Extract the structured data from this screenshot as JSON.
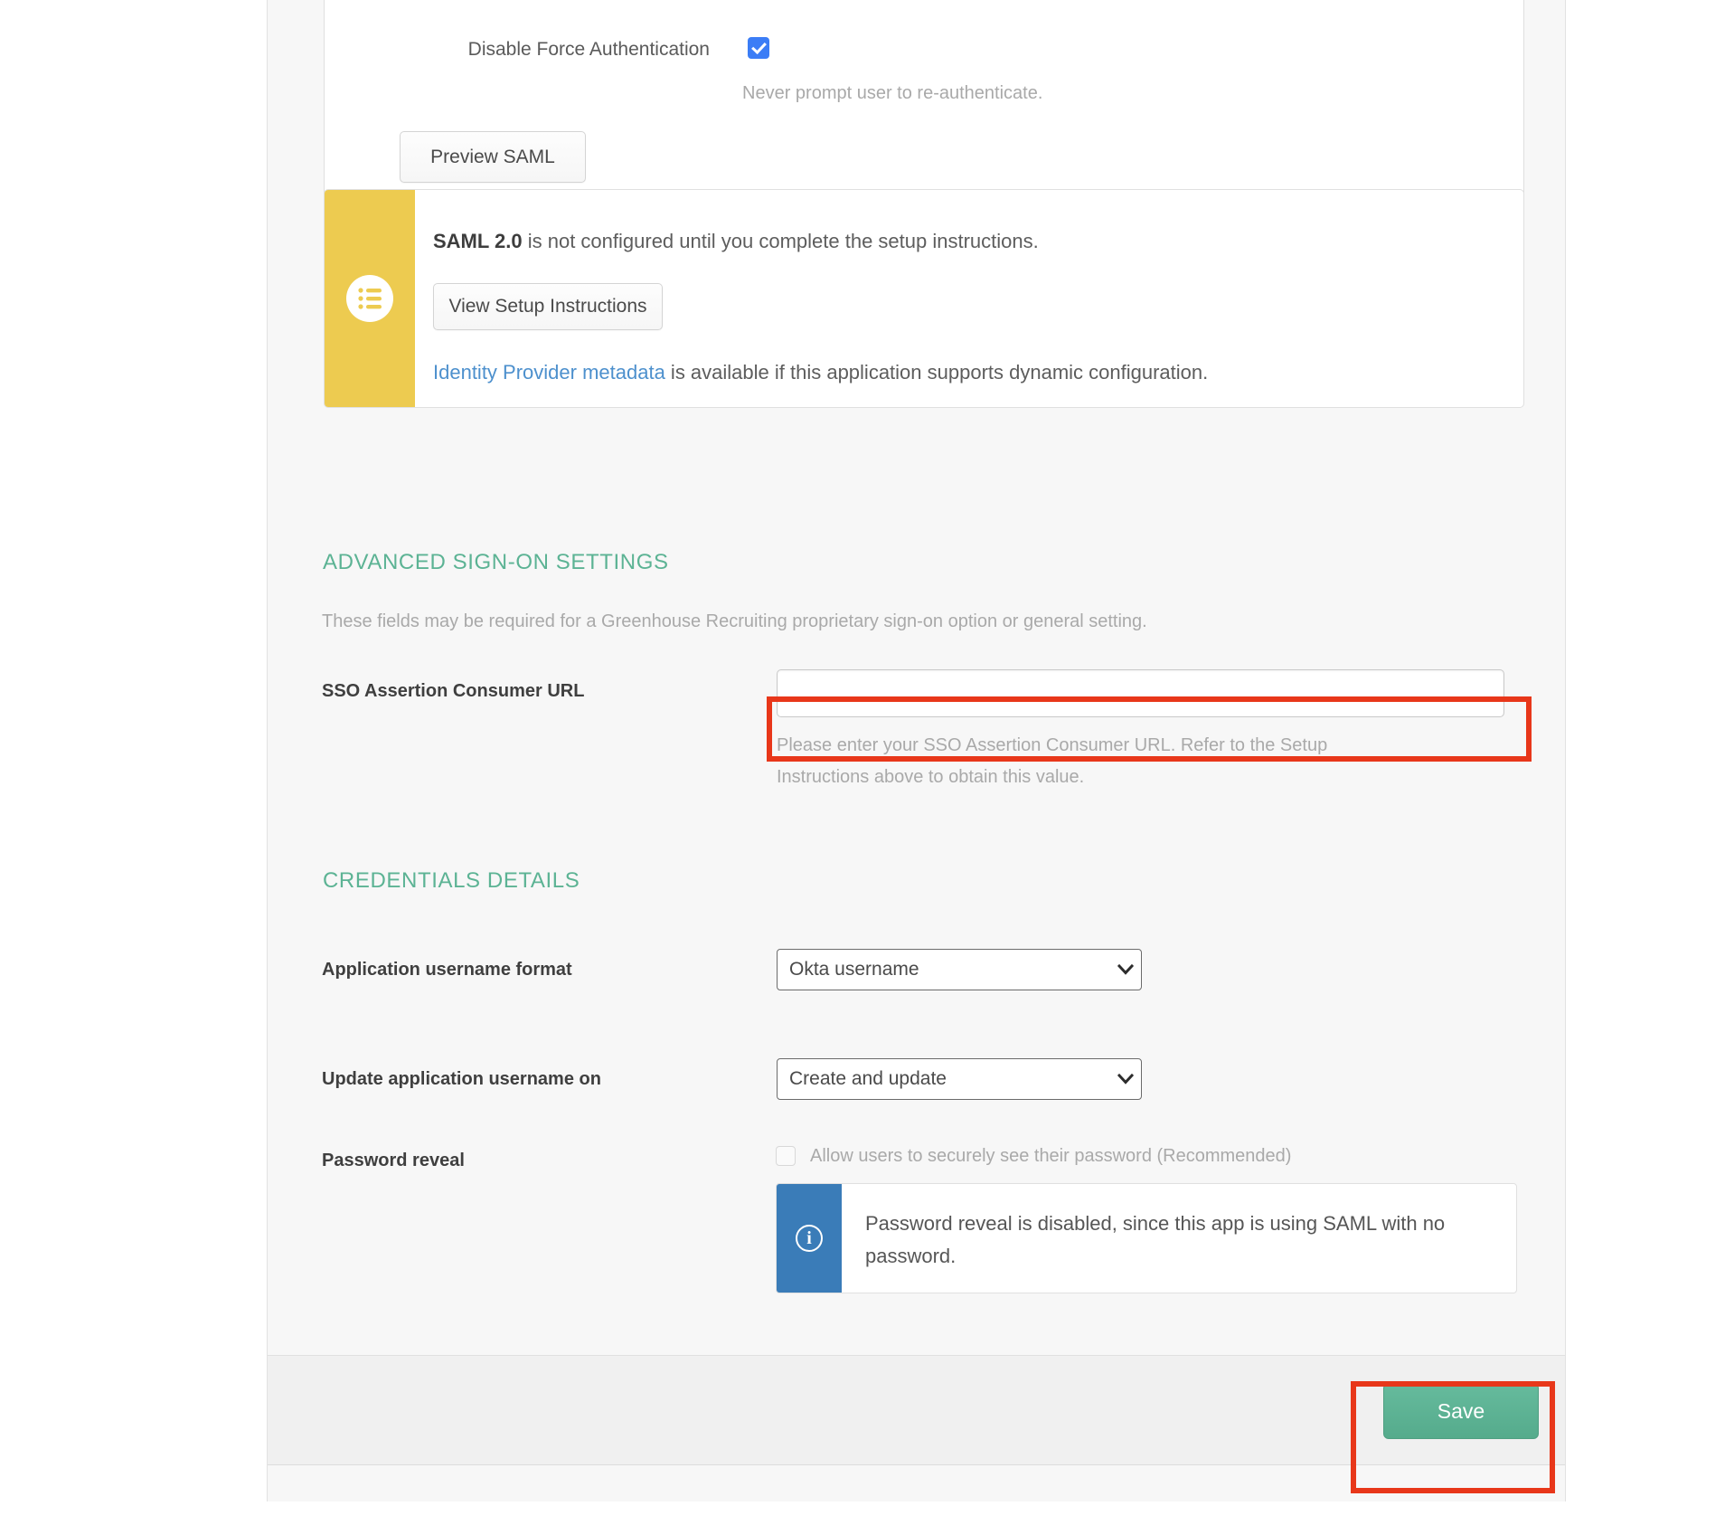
{
  "top_card": {
    "force_auth": {
      "label": "Disable Force Authentication",
      "checkbox_state": "checked",
      "helper": "Never prompt user to re-authenticate."
    },
    "preview_button": "Preview SAML"
  },
  "notice": {
    "icon": "list-icon",
    "accent_color": "#edcb50",
    "strong": "SAML 2.0",
    "message": " is not configured until you complete the setup instructions.",
    "button": "View Setup Instructions",
    "link_text": "Identity Provider metadata",
    "link_suffix": " is available if this application supports dynamic configuration."
  },
  "advanced": {
    "heading": "ADVANCED SIGN-ON SETTINGS",
    "description": "These fields may be required for a Greenhouse Recruiting proprietary sign-on option or general setting.",
    "sso_field": {
      "label": "SSO Assertion Consumer URL",
      "value": "",
      "placeholder": "",
      "helper": "Please enter your SSO Assertion Consumer URL. Refer to the Setup Instructions above to obtain this value.",
      "highlighted": true
    }
  },
  "credentials": {
    "heading": "CREDENTIALS DETAILS",
    "username_format": {
      "label": "Application username format",
      "value": "Okta username"
    },
    "update_username_on": {
      "label": "Update application username on",
      "value": "Create and update"
    },
    "password_reveal": {
      "label": "Password reveal",
      "checkbox_label": "Allow users to securely see their password (Recommended)",
      "checkbox_state": "unchecked",
      "info": {
        "icon": "info-icon",
        "accent_color": "#3a7cb8",
        "text": "Password reveal is disabled, since this app is using SAML with no password."
      }
    }
  },
  "footer": {
    "save_label": "Save",
    "save_color": "#5cb394",
    "highlighted": true
  },
  "annotation": {
    "color": "#e8371a"
  }
}
